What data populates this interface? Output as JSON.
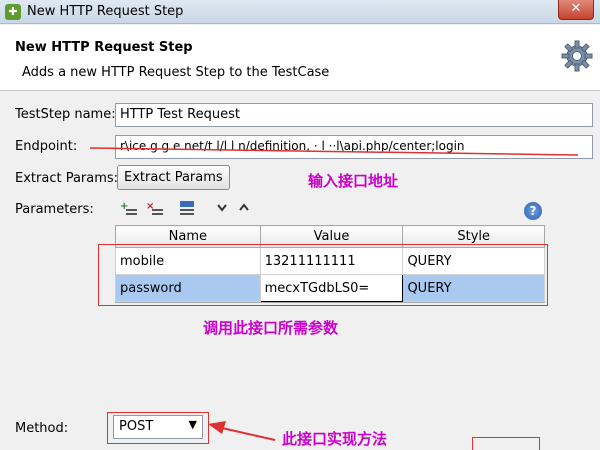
{
  "window": {
    "title": "New HTTP Request Step",
    "close_label": "✕"
  },
  "header": {
    "title": "New HTTP Request Step",
    "description": "Adds a new HTTP Request Step to the TestCase"
  },
  "form": {
    "teststep_label": "TestStep name:",
    "teststep_value": "HTTP Test Request",
    "endpoint_label": "Endpoint:",
    "endpoint_value": "r\\ice.g   g   e net/t    l/l  l  n/definition,   ·  l  ··l\\api.php/center;login",
    "extract_label": "Extract Params:",
    "extract_button": "Extract Params",
    "parameters_label": "Parameters:",
    "method_label": "Method:",
    "method_value": "POST"
  },
  "params_table": {
    "columns": [
      "Name",
      "Value",
      "Style"
    ],
    "rows": [
      {
        "name": "mobile",
        "value": "13211111111",
        "style": "QUERY"
      },
      {
        "name": "password",
        "value": "mecxTGdbLS0=",
        "style": "QUERY"
      }
    ]
  },
  "annotations": {
    "endpoint_note": "输入接口地址",
    "params_note": "调用此接口所需参数",
    "method_note": "此接口实现方法"
  },
  "icons": [
    "app-icon",
    "gear-icon",
    "add-param-icon",
    "remove-param-icon",
    "url-param-icon",
    "move-down-icon",
    "move-up-icon",
    "help-icon"
  ],
  "colors": {
    "annotation": "#cc00cc",
    "highlight": "#e03030",
    "selected_row": "#a9c9f1"
  }
}
